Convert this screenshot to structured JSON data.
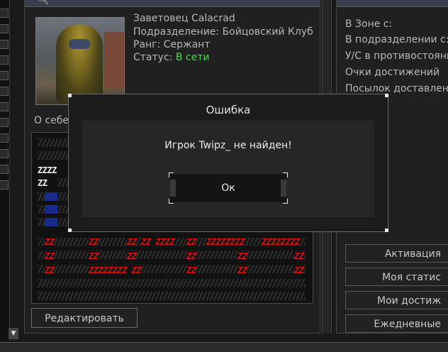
{
  "profile": {
    "name": "Заветовец Calacrad",
    "division": "Подразделение: Бойцовский Клуб",
    "rank": "Ранг: Сержант",
    "status_label": "Статус:",
    "status_value": "В сети",
    "about_label": "О себе"
  },
  "about": {
    "white_lines": [
      "ZZZZ",
      "ZZ"
    ],
    "red_lines": [
      [
        "ZZ",
        "ZZ",
        "ZZ",
        "ZZ ZZZZ",
        "ZZ",
        "ZZZZZZZZ",
        "ZZZZZZZZ"
      ],
      [
        "ZZ",
        "ZZ",
        "ZZ",
        "ZZ",
        "ZZ",
        "ZZ"
      ],
      [
        "ZZ",
        "ZZZZZZZZ ZZ",
        "ZZ",
        "ZZ",
        "ZZ"
      ]
    ]
  },
  "edit_button_label": "Редактировать",
  "stats": [
    "В Зоне с:",
    "В подразделении с:",
    "У/С в противостоянии",
    "Очки достижений",
    "Посылок доставлено"
  ],
  "side_buttons": [
    "Активация",
    "Моя статис",
    "Мои достиж",
    "Ежедневные"
  ],
  "modal": {
    "title": "Ошибка",
    "message": "Игрок Twipz_ не найден!",
    "ok_label": "Ок"
  },
  "icons": {
    "search": "search-icon",
    "scroll_down": "triangle-down-icon"
  },
  "colors": {
    "status_online": "#3fe040",
    "about_red": "#d11111",
    "about_blue": "#1a2a8a",
    "header_bar": "#3a3d4e"
  }
}
